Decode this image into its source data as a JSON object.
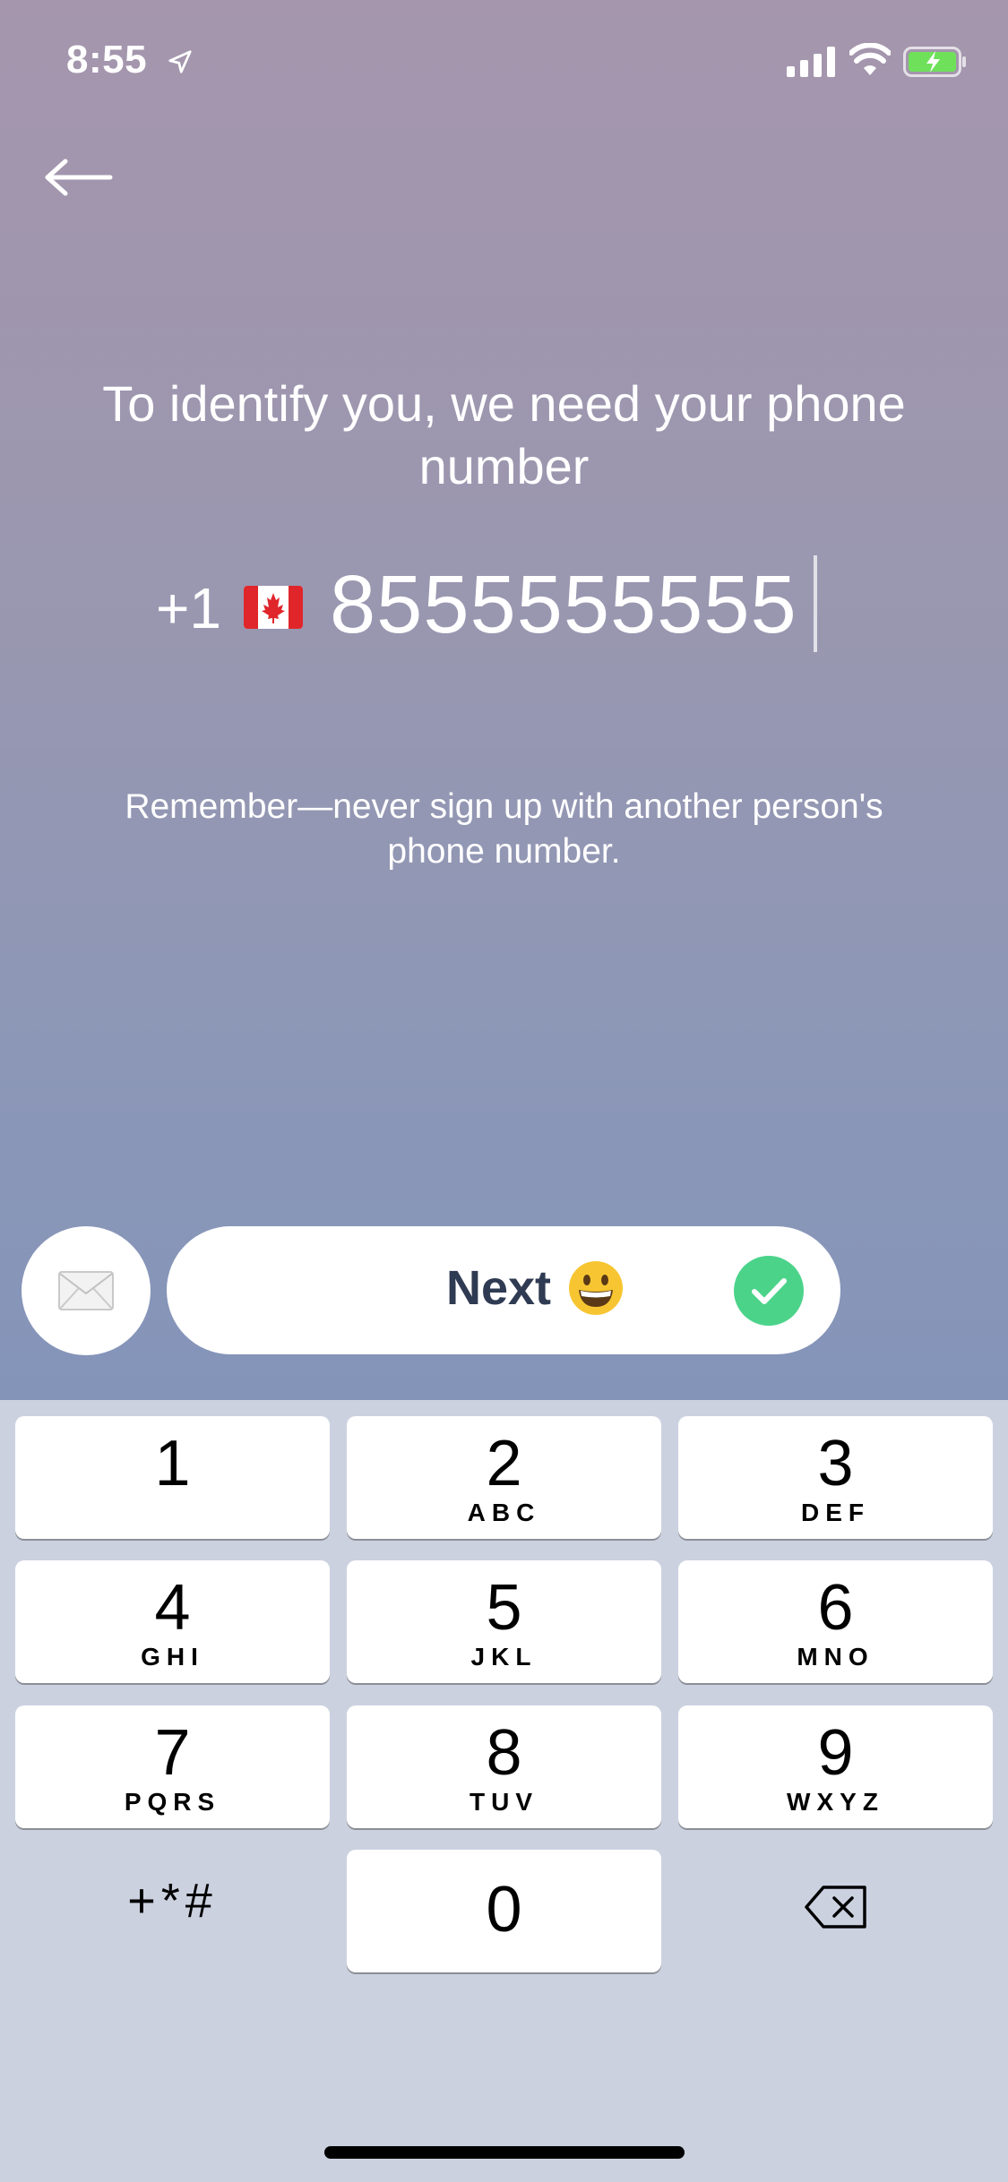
{
  "status_bar": {
    "time": "8:55"
  },
  "header": {
    "back_icon": "arrow-left-icon"
  },
  "main": {
    "title": "To identify you, we need your phone number",
    "country_code": "+1",
    "country_flag": "canada-flag",
    "phone_number": "8555555555",
    "reminder": "Remember—never sign up with another person's phone number."
  },
  "actions": {
    "mail_icon": "envelope-icon",
    "next_label": "Next",
    "next_emoji": "grinning-face",
    "check_color": "#4cd38a"
  },
  "keypad": {
    "keys": [
      {
        "digit": "1",
        "letters": ""
      },
      {
        "digit": "2",
        "letters": "ABC"
      },
      {
        "digit": "3",
        "letters": "DEF"
      },
      {
        "digit": "4",
        "letters": "GHI"
      },
      {
        "digit": "5",
        "letters": "JKL"
      },
      {
        "digit": "6",
        "letters": "MNO"
      },
      {
        "digit": "7",
        "letters": "PQRS"
      },
      {
        "digit": "8",
        "letters": "TUV"
      },
      {
        "digit": "9",
        "letters": "WXYZ"
      },
      {
        "digit": "0",
        "letters": ""
      }
    ],
    "symbols_label": "+*#",
    "delete_icon": "backspace-icon"
  }
}
